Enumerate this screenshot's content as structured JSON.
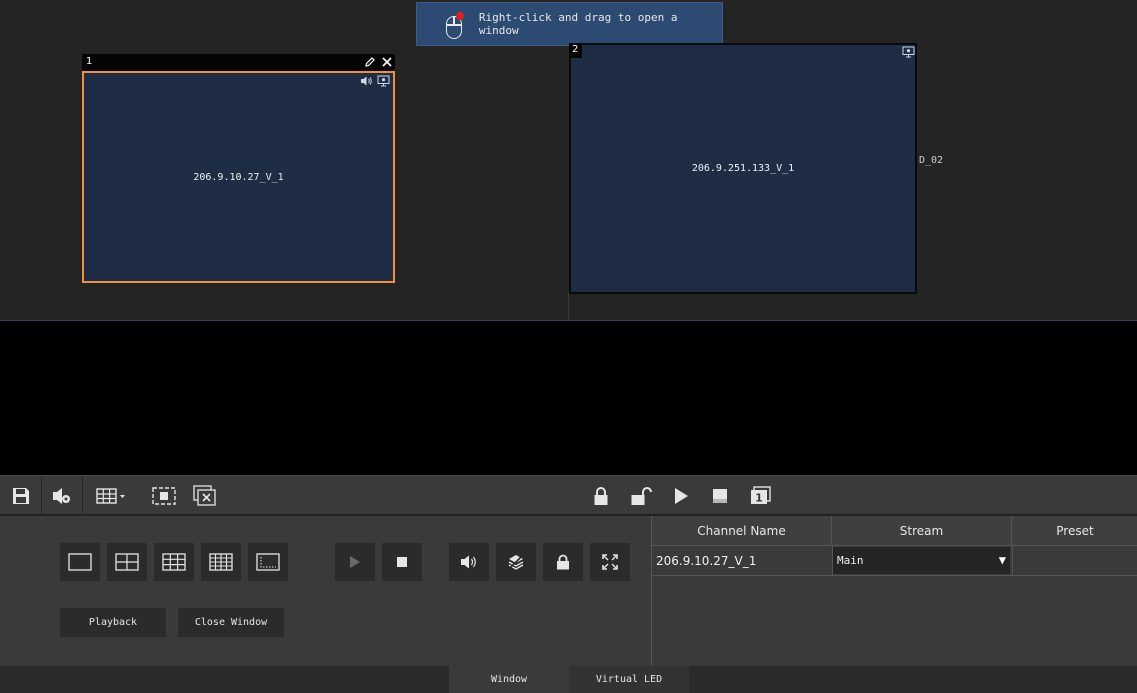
{
  "hint": {
    "text": "Right-click and drag to open a window",
    "icon": "mouse-right-click-icon"
  },
  "windows": [
    {
      "number": "1",
      "label": "206.9.10.27_V_1",
      "selected": true,
      "icons": [
        "speaker-icon",
        "monitor-icon"
      ],
      "title_icons": [
        "pencil-icon",
        "close-icon"
      ]
    },
    {
      "number": "2",
      "label": "206.9.251.133_V_1",
      "selected": false,
      "icons": [
        "monitor-icon"
      ]
    }
  ],
  "side_label": "D_02",
  "toolbar": {
    "left": [
      "save-icon",
      "audio-settings-icon",
      "grid-dropdown-icon",
      "center-window-icon",
      "close-all-windows-icon"
    ],
    "center": [
      "lock-icon",
      "unlock-icon",
      "play-icon",
      "stop-icon",
      "single-screen-icon"
    ]
  },
  "controls": {
    "layouts": [
      "layout-1x1-icon",
      "layout-2x2-icon",
      "layout-3x3-icon",
      "layout-4x4-icon",
      "layout-custom-icon"
    ],
    "playback": [
      "play-icon",
      "stop-icon"
    ],
    "tools": [
      "audio-icon",
      "layers-icon",
      "lock-icon",
      "fullscreen-icon"
    ],
    "playback_label": "Playback",
    "close_window_label": "Close Window"
  },
  "table": {
    "headers": {
      "channel": "Channel Name",
      "stream": "Stream",
      "preset": "Preset"
    },
    "rows": [
      {
        "channel": "206.9.10.27_V_1",
        "stream": "Main",
        "preset": ""
      }
    ]
  },
  "tabs": {
    "window": "Window",
    "virtual_led": "Virtual LED",
    "active": "Window"
  },
  "colors": {
    "accent_selected": "#f0913a",
    "pane": "#1e2d45",
    "hint_bg": "#2c4a72"
  }
}
